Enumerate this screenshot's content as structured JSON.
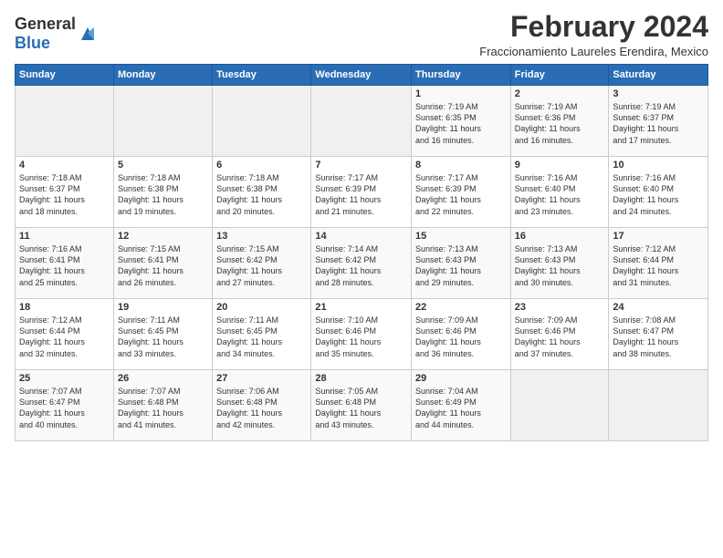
{
  "header": {
    "logo_general": "General",
    "logo_blue": "Blue",
    "month": "February 2024",
    "location": "Fraccionamiento Laureles Erendira, Mexico"
  },
  "weekdays": [
    "Sunday",
    "Monday",
    "Tuesday",
    "Wednesday",
    "Thursday",
    "Friday",
    "Saturday"
  ],
  "weeks": [
    [
      {
        "day": "",
        "info": ""
      },
      {
        "day": "",
        "info": ""
      },
      {
        "day": "",
        "info": ""
      },
      {
        "day": "",
        "info": ""
      },
      {
        "day": "1",
        "info": "Sunrise: 7:19 AM\nSunset: 6:35 PM\nDaylight: 11 hours\nand 16 minutes."
      },
      {
        "day": "2",
        "info": "Sunrise: 7:19 AM\nSunset: 6:36 PM\nDaylight: 11 hours\nand 16 minutes."
      },
      {
        "day": "3",
        "info": "Sunrise: 7:19 AM\nSunset: 6:37 PM\nDaylight: 11 hours\nand 17 minutes."
      }
    ],
    [
      {
        "day": "4",
        "info": "Sunrise: 7:18 AM\nSunset: 6:37 PM\nDaylight: 11 hours\nand 18 minutes."
      },
      {
        "day": "5",
        "info": "Sunrise: 7:18 AM\nSunset: 6:38 PM\nDaylight: 11 hours\nand 19 minutes."
      },
      {
        "day": "6",
        "info": "Sunrise: 7:18 AM\nSunset: 6:38 PM\nDaylight: 11 hours\nand 20 minutes."
      },
      {
        "day": "7",
        "info": "Sunrise: 7:17 AM\nSunset: 6:39 PM\nDaylight: 11 hours\nand 21 minutes."
      },
      {
        "day": "8",
        "info": "Sunrise: 7:17 AM\nSunset: 6:39 PM\nDaylight: 11 hours\nand 22 minutes."
      },
      {
        "day": "9",
        "info": "Sunrise: 7:16 AM\nSunset: 6:40 PM\nDaylight: 11 hours\nand 23 minutes."
      },
      {
        "day": "10",
        "info": "Sunrise: 7:16 AM\nSunset: 6:40 PM\nDaylight: 11 hours\nand 24 minutes."
      }
    ],
    [
      {
        "day": "11",
        "info": "Sunrise: 7:16 AM\nSunset: 6:41 PM\nDaylight: 11 hours\nand 25 minutes."
      },
      {
        "day": "12",
        "info": "Sunrise: 7:15 AM\nSunset: 6:41 PM\nDaylight: 11 hours\nand 26 minutes."
      },
      {
        "day": "13",
        "info": "Sunrise: 7:15 AM\nSunset: 6:42 PM\nDaylight: 11 hours\nand 27 minutes."
      },
      {
        "day": "14",
        "info": "Sunrise: 7:14 AM\nSunset: 6:42 PM\nDaylight: 11 hours\nand 28 minutes."
      },
      {
        "day": "15",
        "info": "Sunrise: 7:13 AM\nSunset: 6:43 PM\nDaylight: 11 hours\nand 29 minutes."
      },
      {
        "day": "16",
        "info": "Sunrise: 7:13 AM\nSunset: 6:43 PM\nDaylight: 11 hours\nand 30 minutes."
      },
      {
        "day": "17",
        "info": "Sunrise: 7:12 AM\nSunset: 6:44 PM\nDaylight: 11 hours\nand 31 minutes."
      }
    ],
    [
      {
        "day": "18",
        "info": "Sunrise: 7:12 AM\nSunset: 6:44 PM\nDaylight: 11 hours\nand 32 minutes."
      },
      {
        "day": "19",
        "info": "Sunrise: 7:11 AM\nSunset: 6:45 PM\nDaylight: 11 hours\nand 33 minutes."
      },
      {
        "day": "20",
        "info": "Sunrise: 7:11 AM\nSunset: 6:45 PM\nDaylight: 11 hours\nand 34 minutes."
      },
      {
        "day": "21",
        "info": "Sunrise: 7:10 AM\nSunset: 6:46 PM\nDaylight: 11 hours\nand 35 minutes."
      },
      {
        "day": "22",
        "info": "Sunrise: 7:09 AM\nSunset: 6:46 PM\nDaylight: 11 hours\nand 36 minutes."
      },
      {
        "day": "23",
        "info": "Sunrise: 7:09 AM\nSunset: 6:46 PM\nDaylight: 11 hours\nand 37 minutes."
      },
      {
        "day": "24",
        "info": "Sunrise: 7:08 AM\nSunset: 6:47 PM\nDaylight: 11 hours\nand 38 minutes."
      }
    ],
    [
      {
        "day": "25",
        "info": "Sunrise: 7:07 AM\nSunset: 6:47 PM\nDaylight: 11 hours\nand 40 minutes."
      },
      {
        "day": "26",
        "info": "Sunrise: 7:07 AM\nSunset: 6:48 PM\nDaylight: 11 hours\nand 41 minutes."
      },
      {
        "day": "27",
        "info": "Sunrise: 7:06 AM\nSunset: 6:48 PM\nDaylight: 11 hours\nand 42 minutes."
      },
      {
        "day": "28",
        "info": "Sunrise: 7:05 AM\nSunset: 6:48 PM\nDaylight: 11 hours\nand 43 minutes."
      },
      {
        "day": "29",
        "info": "Sunrise: 7:04 AM\nSunset: 6:49 PM\nDaylight: 11 hours\nand 44 minutes."
      },
      {
        "day": "",
        "info": ""
      },
      {
        "day": "",
        "info": ""
      }
    ]
  ]
}
